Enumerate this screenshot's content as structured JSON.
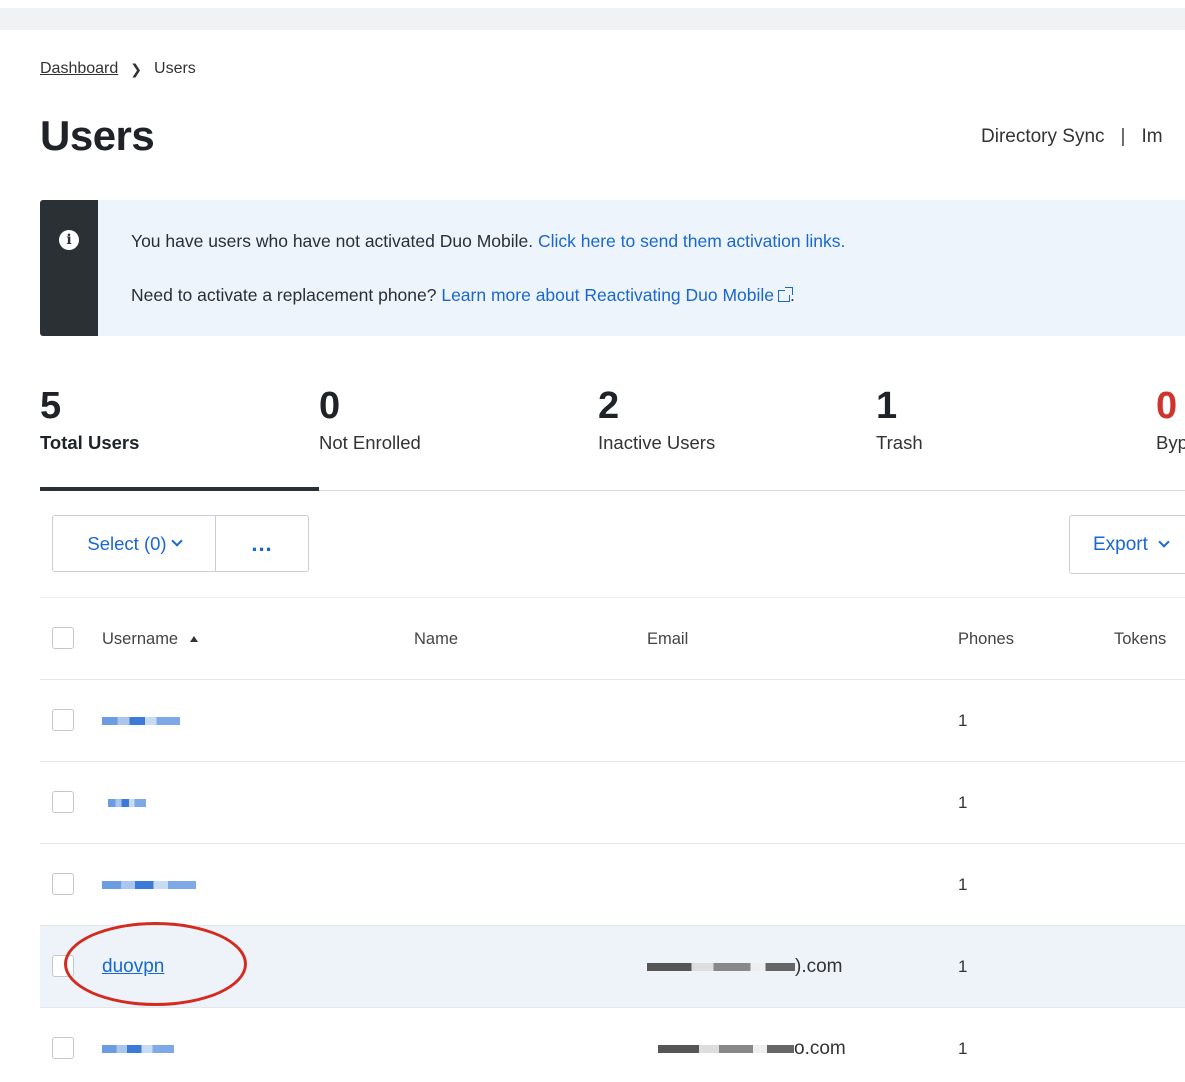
{
  "breadcrumb": {
    "parent": "Dashboard",
    "current": "Users"
  },
  "page_title": "Users",
  "top_actions": {
    "directory_sync": "Directory Sync",
    "separator": "|",
    "import_truncated": "Im"
  },
  "alert": {
    "line1_text": "You have users who have not activated Duo Mobile. ",
    "line1_link": "Click here to send them activation links.",
    "line2_text": "Need to activate a replacement phone? ",
    "line2_link": "Learn more about Reactivating Duo Mobile",
    "line2_end": "."
  },
  "stats": [
    {
      "value": "5",
      "label": "Total Users"
    },
    {
      "value": "0",
      "label": "Not Enrolled"
    },
    {
      "value": "2",
      "label": "Inactive Users"
    },
    {
      "value": "1",
      "label": "Trash"
    },
    {
      "value": "0",
      "label": "Byp"
    }
  ],
  "toolbar": {
    "select_label": "Select (0)",
    "more_label": "...",
    "export_label": "Export"
  },
  "table": {
    "columns": {
      "username": "Username",
      "name": "Name",
      "email": "Email",
      "phones": "Phones",
      "tokens": "Tokens"
    },
    "rows": [
      {
        "username": "",
        "email": "",
        "phones": "1"
      },
      {
        "username": "",
        "email": "",
        "phones": "1"
      },
      {
        "username": "",
        "email": "",
        "phones": "1"
      },
      {
        "username": "duovpn",
        "email": ").com",
        "phones": "1"
      },
      {
        "username": "",
        "email": "o.com",
        "phones": "1"
      }
    ]
  },
  "colors": {
    "link": "#1967d2",
    "danger": "#d1342f",
    "alert_bg": "#eef4fb",
    "alert_strip": "#2b3035",
    "annotation": "#d42b20"
  }
}
